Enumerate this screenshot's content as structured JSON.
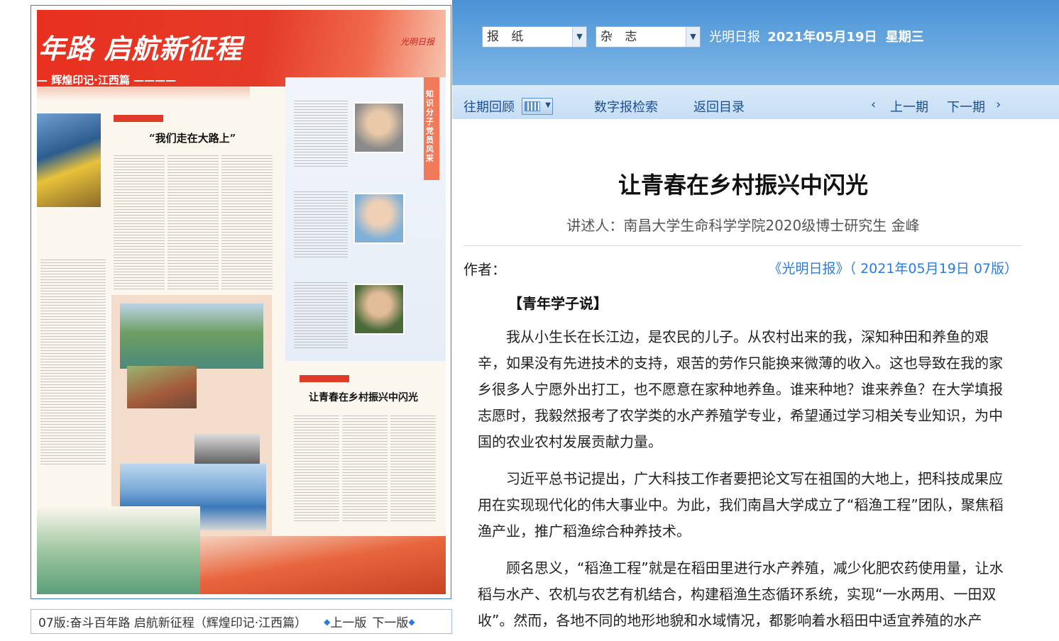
{
  "header": {
    "select_newspaper": "报 纸",
    "select_magazine": "杂 志",
    "paper_name": "光明日报",
    "date": "2021年05月19日",
    "weekday": "星期三"
  },
  "nav": {
    "past_review": "往期回顾",
    "digital_search": "数字报检索",
    "back_to_contents": "返回目录",
    "prev_issue": "上一期",
    "next_issue": "下一期"
  },
  "page_preview": {
    "banner_title": "年路 启航新征程",
    "banner_subtitle": "— 辉煌印记·江西篇 ————",
    "masthead": "光明日报",
    "headline_1": "“我们走在大路上”",
    "headline_2": "让青春在乡村振兴中闪光",
    "side_label": "知识分子党员风采",
    "caption": "07版:奋斗百年路 启航新征程（辉煌印记·江西篇）",
    "prev_page": "上一版",
    "next_page": "下一版"
  },
  "article": {
    "title": "让青春在乡村振兴中闪光",
    "subtitle": "讲述人：南昌大学生命科学学院2020级博士研究生  金峰",
    "author_label": "作者：",
    "source": "《光明日报》（ 2021年05月19日   07版）",
    "section": "【青年学子说】",
    "paragraphs": [
      "我从小生长在长江边，是农民的儿子。从农村出来的我，深知种田和养鱼的艰辛，如果没有先进技术的支持，艰苦的劳作只能换来微薄的收入。这也导致在我的家乡很多人宁愿外出打工，也不愿意在家种地养鱼。谁来种地？谁来养鱼？在大学填报志愿时，我毅然报考了农学类的水产养殖学专业，希望通过学习相关专业知识，为中国的农业农村发展贡献力量。",
      "习近平总书记提出，广大科技工作者要把论文写在祖国的大地上，把科技成果应用在实现现代化的伟大事业中。为此，我们南昌大学成立了“稻渔工程”团队，聚焦稻渔产业，推广稻渔综合种养技术。",
      "顾名思义，“稻渔工程”就是在稻田里进行水产养殖，减少化肥农药使用量，让水稻与水产、农机与农艺有机结合，构建稻渔生态循环系统，实现“一水两用、一田双收”。然而，各地不同的地形地貌和水域情况，都影响着水稻田中适宜养殖的水产"
    ]
  },
  "colors": {
    "header_blue": "#4a93d6",
    "nav_blue": "#c6def5",
    "link_blue": "#2a7be0",
    "banner_red": "#e8301f"
  }
}
